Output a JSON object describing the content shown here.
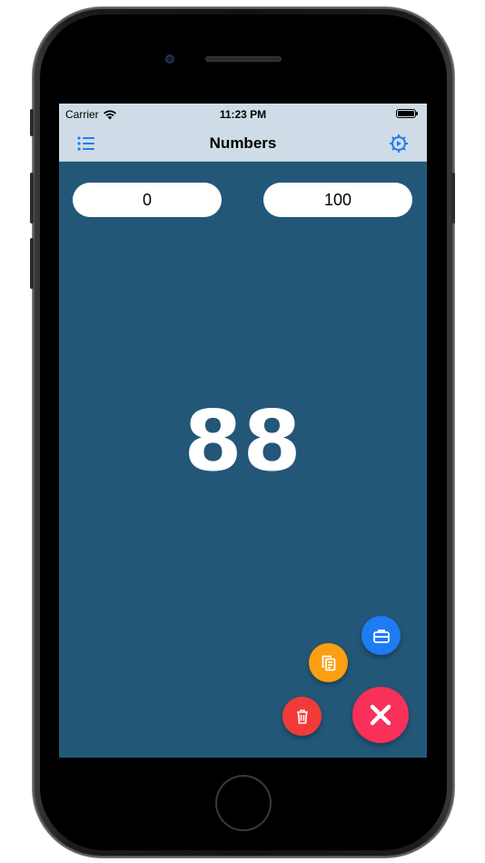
{
  "status_bar": {
    "carrier": "Carrier",
    "time": "11:23 PM",
    "wifi_icon": "wifi-icon",
    "battery_icon": "battery-icon"
  },
  "nav": {
    "title": "Numbers",
    "left_icon": "list-icon",
    "right_icon": "gear-icon",
    "bar_color": "#cfdce7",
    "icon_color": "#1e7cf2"
  },
  "range": {
    "min_value": "0",
    "max_value": "100"
  },
  "result": {
    "value": "88"
  },
  "actions": [
    {
      "icon": "briefcase-icon",
      "color": "#1e7cf2"
    },
    {
      "icon": "copy-icon",
      "color": "#fb9e0f"
    },
    {
      "icon": "trash-icon",
      "color": "#f23b39"
    },
    {
      "icon": "close-icon",
      "color": "#f8305a"
    }
  ],
  "background_color": "#235778"
}
